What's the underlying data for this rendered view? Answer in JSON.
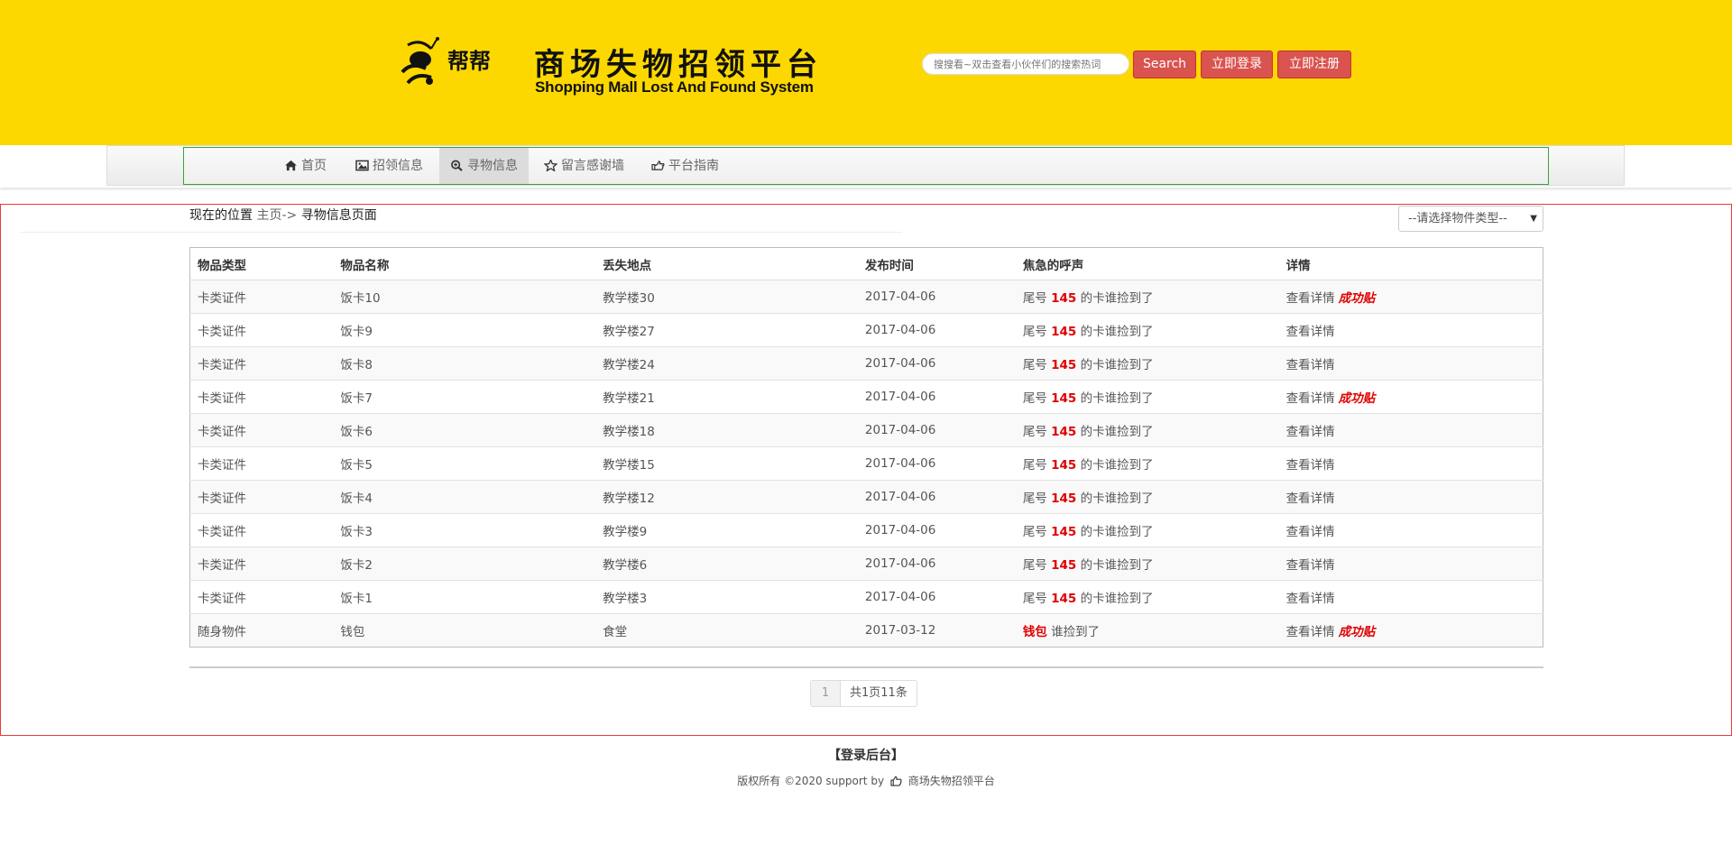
{
  "header": {
    "logo_text": "帮帮",
    "title_cn": "商场失物招领平台",
    "title_en": "Shopping Mall Lost And Found System",
    "search_placeholder": "搜搜看~双击查看小伙伴们的搜索热词",
    "search_button": "Search",
    "login_button": "立即登录",
    "register_button": "立即注册",
    "brand_color": "#fdd800",
    "button_color": "#d9534f"
  },
  "nav": {
    "items": [
      {
        "label": "首页",
        "icon": "home-icon"
      },
      {
        "label": "招领信息",
        "icon": "picture-icon"
      },
      {
        "label": "寻物信息",
        "icon": "zoom-in-icon",
        "active": true
      },
      {
        "label": "留言感谢墙",
        "icon": "star-icon"
      },
      {
        "label": "平台指南",
        "icon": "hand-right-icon"
      }
    ]
  },
  "breadcrumb": {
    "prefix": "现在的位置",
    "home": "主页->",
    "current": "寻物信息页面"
  },
  "filter": {
    "selected": "--请选择物件类型--"
  },
  "table": {
    "headers": [
      "物品类型",
      "物品名称",
      "丢失地点",
      "发布时间",
      "焦急的呼声",
      "详情"
    ],
    "rows": [
      {
        "type": "卡类证件",
        "name": "饭卡10",
        "place": "教学楼30",
        "date": "2017-04-06",
        "call_pre": "尾号",
        "call_hl": "145",
        "call_post": "的卡谁捡到了",
        "detail": "查看详情",
        "badge": "成功贴"
      },
      {
        "type": "卡类证件",
        "name": "饭卡9",
        "place": "教学楼27",
        "date": "2017-04-06",
        "call_pre": "尾号",
        "call_hl": "145",
        "call_post": "的卡谁捡到了",
        "detail": "查看详情",
        "badge": ""
      },
      {
        "type": "卡类证件",
        "name": "饭卡8",
        "place": "教学楼24",
        "date": "2017-04-06",
        "call_pre": "尾号",
        "call_hl": "145",
        "call_post": "的卡谁捡到了",
        "detail": "查看详情",
        "badge": ""
      },
      {
        "type": "卡类证件",
        "name": "饭卡7",
        "place": "教学楼21",
        "date": "2017-04-06",
        "call_pre": "尾号",
        "call_hl": "145",
        "call_post": "的卡谁捡到了",
        "detail": "查看详情",
        "badge": "成功贴"
      },
      {
        "type": "卡类证件",
        "name": "饭卡6",
        "place": "教学楼18",
        "date": "2017-04-06",
        "call_pre": "尾号",
        "call_hl": "145",
        "call_post": "的卡谁捡到了",
        "detail": "查看详情",
        "badge": ""
      },
      {
        "type": "卡类证件",
        "name": "饭卡5",
        "place": "教学楼15",
        "date": "2017-04-06",
        "call_pre": "尾号",
        "call_hl": "145",
        "call_post": "的卡谁捡到了",
        "detail": "查看详情",
        "badge": ""
      },
      {
        "type": "卡类证件",
        "name": "饭卡4",
        "place": "教学楼12",
        "date": "2017-04-06",
        "call_pre": "尾号",
        "call_hl": "145",
        "call_post": "的卡谁捡到了",
        "detail": "查看详情",
        "badge": ""
      },
      {
        "type": "卡类证件",
        "name": "饭卡3",
        "place": "教学楼9",
        "date": "2017-04-06",
        "call_pre": "尾号",
        "call_hl": "145",
        "call_post": "的卡谁捡到了",
        "detail": "查看详情",
        "badge": ""
      },
      {
        "type": "卡类证件",
        "name": "饭卡2",
        "place": "教学楼6",
        "date": "2017-04-06",
        "call_pre": "尾号",
        "call_hl": "145",
        "call_post": "的卡谁捡到了",
        "detail": "查看详情",
        "badge": ""
      },
      {
        "type": "卡类证件",
        "name": "饭卡1",
        "place": "教学楼3",
        "date": "2017-04-06",
        "call_pre": "尾号",
        "call_hl": "145",
        "call_post": "的卡谁捡到了",
        "detail": "查看详情",
        "badge": ""
      },
      {
        "type": "随身物件",
        "name": "钱包",
        "place": "食堂",
        "date": "2017-03-12",
        "call_pre": "",
        "call_hl": "钱包",
        "call_post": "谁捡到了",
        "detail": "查看详情",
        "badge": "成功贴"
      }
    ]
  },
  "pagination": {
    "current_page": "1",
    "summary": "共1页11条"
  },
  "footer": {
    "admin_link": "【登录后台】",
    "copyright_pre": "版权所有 ©2020 support by",
    "copyright_name": "商场失物招领平台",
    "icon": "thumbs-up-icon"
  }
}
